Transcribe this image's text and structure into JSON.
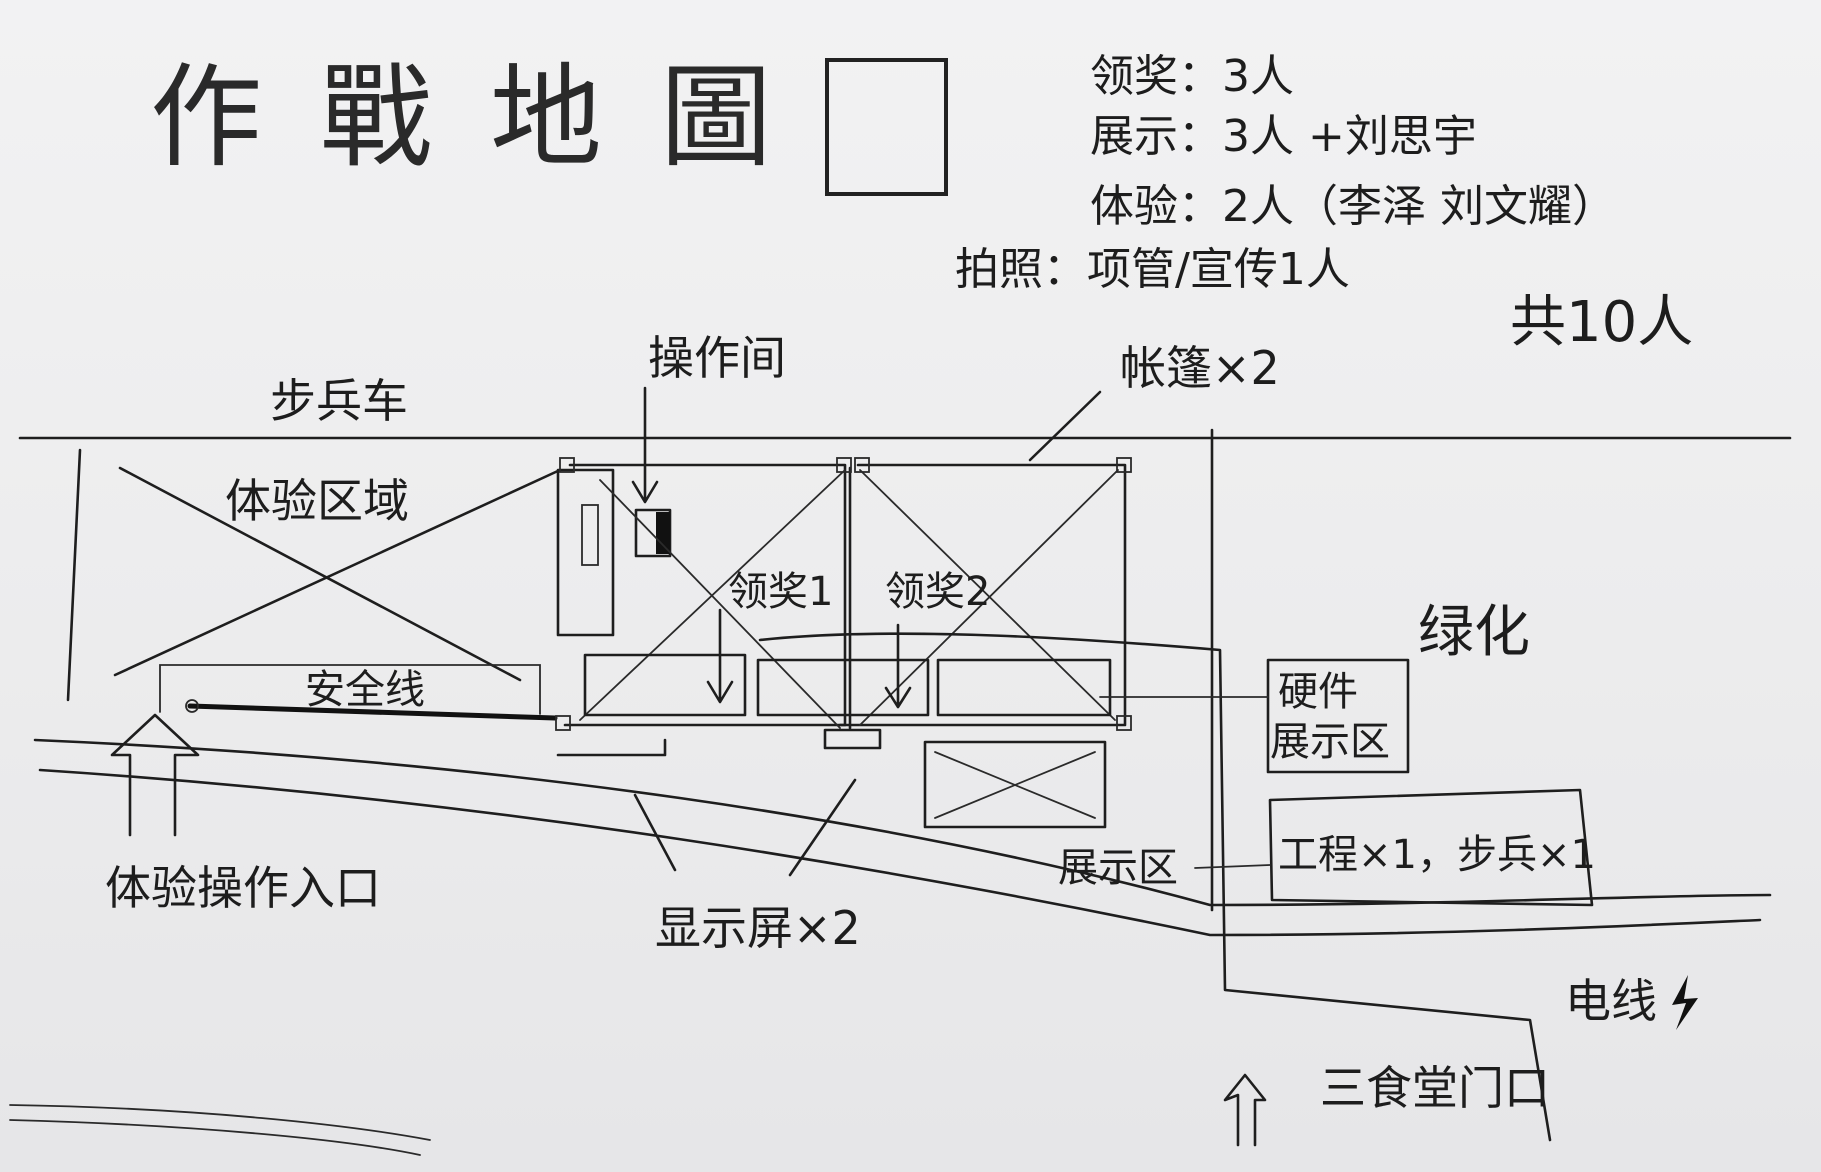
{
  "title": "作戰地圖",
  "staff": {
    "award": "领奖：3人",
    "display": "展示：3人 +刘思宇",
    "experience": "体验：2人（李泽 刘文耀）",
    "photo": "拍照：项管/宣传1人",
    "total": "共10人"
  },
  "labels": {
    "infantry_vehicle": "步兵车",
    "operation_room": "操作间",
    "tents": "帐篷×2",
    "experience_area": "体验区域",
    "safety_line": "安全线",
    "award_1": "领奖1",
    "award_2": "领奖2",
    "greening": "绿化",
    "hardware_display": [
      "硬件",
      "展示区"
    ],
    "display_area": "展示区",
    "vehicles": "工程×1，步兵×1",
    "experience_entrance": "体验操作入口",
    "screens": "显示屏×2",
    "power_line": "电线",
    "canteen_gate": "三食堂门口"
  },
  "icons": {
    "power": "lightning-bolt-icon",
    "entrance_arrow": "up-arrow-icon",
    "gate_arrow": "up-arrow-icon"
  }
}
